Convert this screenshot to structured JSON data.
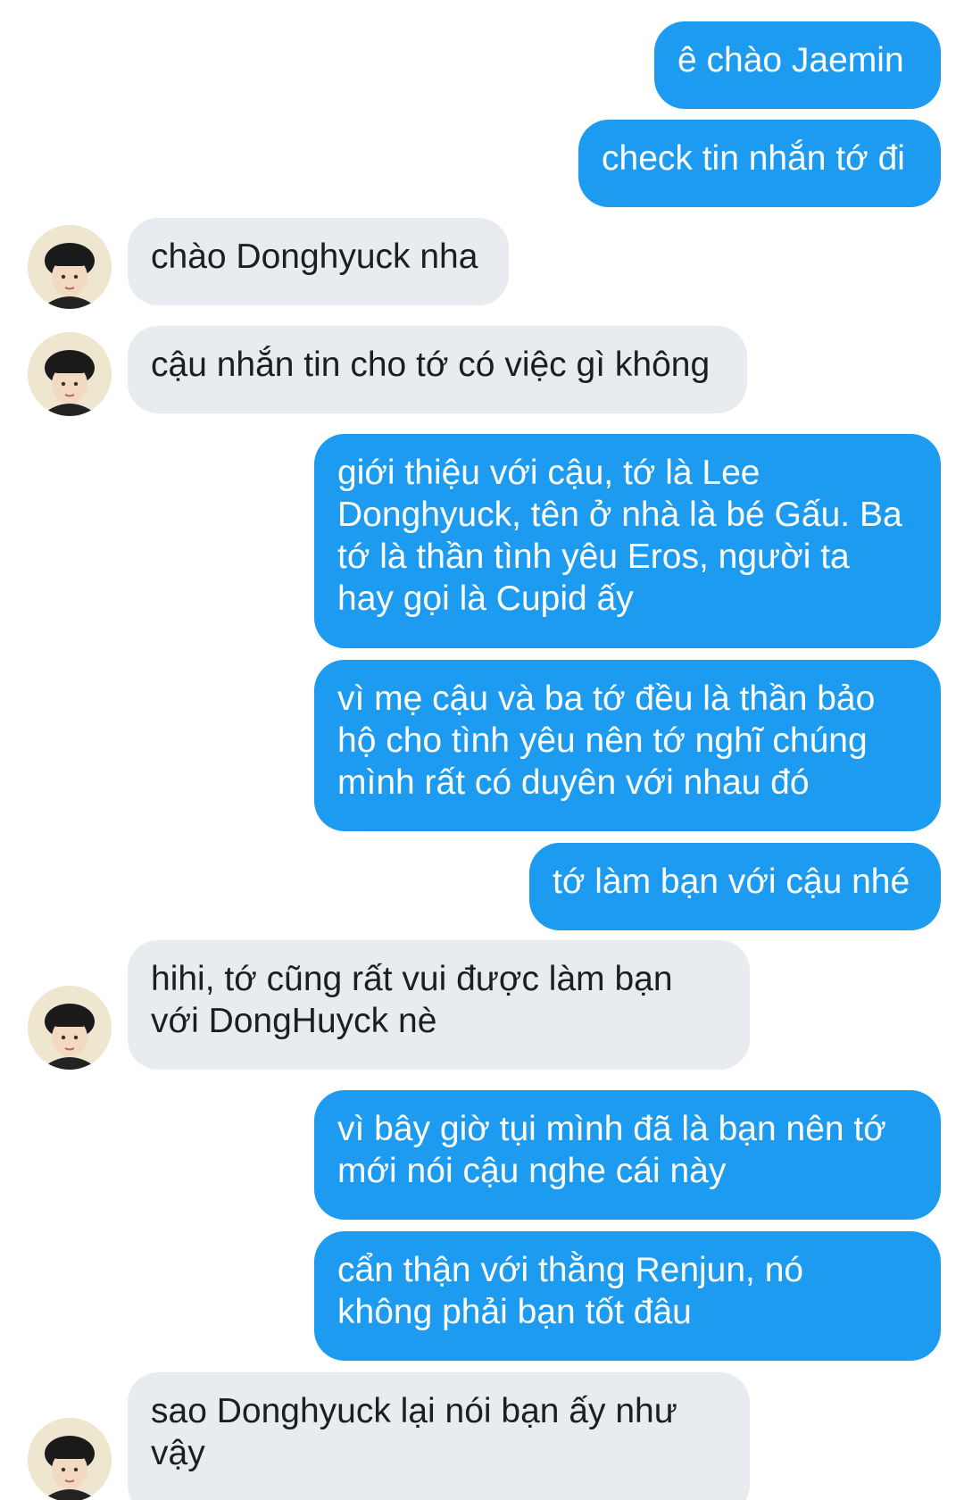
{
  "conversation": {
    "messages": [
      {
        "side": "out",
        "text": "ê chào Jaemin"
      },
      {
        "side": "out",
        "text": "check tin nhắn tớ đi"
      },
      {
        "side": "in",
        "text": "chào Donghyuck nha"
      },
      {
        "side": "in",
        "text": "cậu nhắn tin cho tớ có việc gì không"
      },
      {
        "side": "out",
        "text": "giới thiệu với cậu, tớ là Lee\nDonghyuck, tên ở nhà là bé Gấu. Ba\ntớ là thần tình yêu Eros, người ta\nhay gọi là Cupid ấy"
      },
      {
        "side": "out",
        "text": "vì mẹ cậu và ba tớ đều là thần bảo\nhộ cho tình yêu nên tớ nghĩ chúng\nmình rất có duyên với nhau đó"
      },
      {
        "side": "out",
        "text": "tớ làm bạn với cậu nhé"
      },
      {
        "side": "in",
        "text": "hihi, tớ cũng rất vui được làm bạn\nvới DongHuyck nè"
      },
      {
        "side": "out",
        "text": "vì bây giờ tụi mình đã là bạn nên tớ\nmới nói cậu nghe cái này"
      },
      {
        "side": "out",
        "text": "cẩn thận với thằng Renjun, nó\nkhông phải bạn tốt đâu"
      },
      {
        "side": "in",
        "text": "sao Donghyuck lại nói bạn ấy như\nvậy"
      }
    ]
  },
  "colors": {
    "outgoing_bubble": "#1d9bf0",
    "incoming_bubble": "#e8ebef"
  },
  "icons": {
    "avatar": "contact-avatar-photo"
  }
}
